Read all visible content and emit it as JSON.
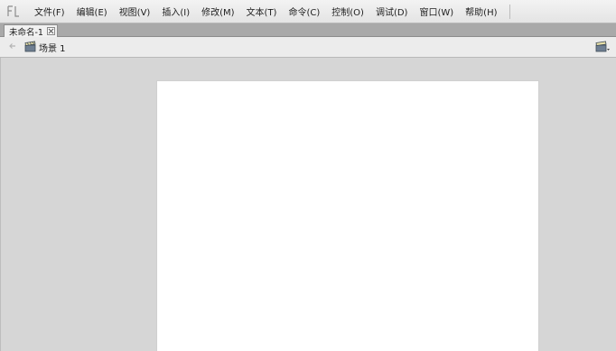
{
  "menubar": {
    "items": [
      "文件(F)",
      "编辑(E)",
      "视图(V)",
      "插入(I)",
      "修改(M)",
      "文本(T)",
      "命令(C)",
      "控制(O)",
      "调试(D)",
      "窗口(W)",
      "帮助(H)"
    ]
  },
  "tabs": {
    "document_title": "未命名-1"
  },
  "scene": {
    "label": "场景 1"
  },
  "icons": {
    "app": "fl-logo-icon",
    "tab_close": "close-icon",
    "back": "back-arrow-icon",
    "scene": "clapperboard-icon",
    "edit_scene": "edit-scene-icon"
  },
  "colors": {
    "stage": "#ffffff",
    "workspace": "#d6d6d6",
    "menubar": "#ececec"
  }
}
